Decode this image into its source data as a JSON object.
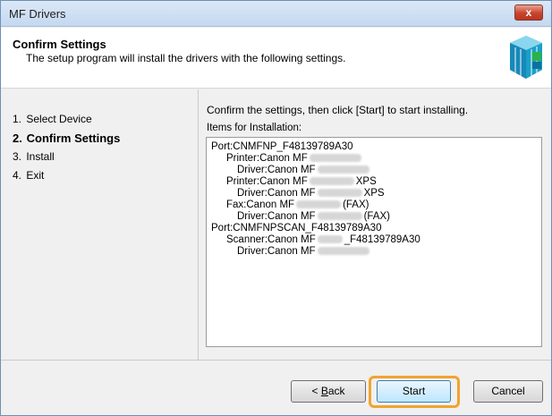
{
  "window": {
    "title": "MF Drivers",
    "close_label": "x"
  },
  "header": {
    "title": "Confirm Settings",
    "description": "The setup program will install the drivers with the following settings."
  },
  "steps": [
    {
      "num": "1.",
      "label": "Select Device"
    },
    {
      "num": "2.",
      "label": "Confirm Settings"
    },
    {
      "num": "3.",
      "label": "Install"
    },
    {
      "num": "4.",
      "label": "Exit"
    }
  ],
  "main": {
    "instruction": "Confirm the settings, then click [Start] to start installing.",
    "list_label": "Items for Installation:",
    "items": {
      "port1": "Port:CNMFNP_F48139789A30",
      "printer1": "Printer:Canon MF",
      "driver1": "Driver:Canon MF",
      "printer2": "Printer:Canon MF",
      "printer2_suffix": "XPS",
      "driver2": "Driver:Canon MF",
      "driver2_suffix": "XPS",
      "fax": "Fax:Canon MF",
      "fax_suffix": "(FAX)",
      "driver3": "Driver:Canon MF",
      "driver3_suffix": "(FAX)",
      "port2": "Port:CNMFNPSCAN_F48139789A30",
      "scanner": "Scanner:Canon MF",
      "scanner_suffix": "_F48139789A30",
      "driver4": "Driver:Canon MF"
    }
  },
  "buttons": {
    "back_accel": "B",
    "back_rest": "ack",
    "back_prefix": "< ",
    "start": "Start",
    "cancel": "Cancel"
  },
  "colors": {
    "highlight_ring": "#f1a330",
    "titlebar": "#c4d8f0"
  }
}
